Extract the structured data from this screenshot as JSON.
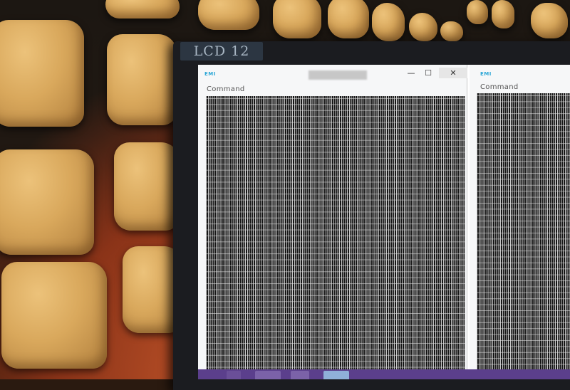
{
  "scene": {
    "monitor_label": "LCD 12",
    "colors": {
      "absorber": "#d9a85c",
      "floor": "#c4562a",
      "monitor_bezel": "#1b1c20",
      "taskbar": "#5b3f8c"
    }
  },
  "window_left": {
    "app_icon": "EMI",
    "command_label": "Command",
    "controls": {
      "minimize": "—",
      "maximize": "☐",
      "close": "✕"
    }
  },
  "window_right": {
    "app_icon": "EMI",
    "command_label": "Command"
  }
}
